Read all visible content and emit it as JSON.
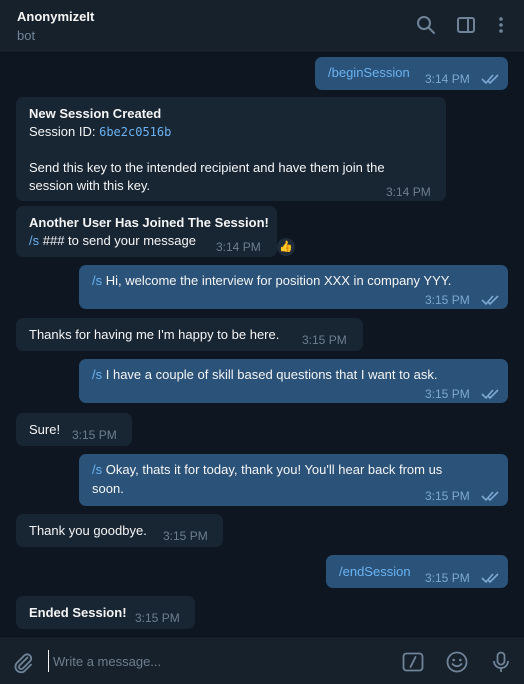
{
  "header": {
    "title": "AnonymizeIt",
    "subtitle": "bot",
    "icons": [
      "search-icon",
      "sidebar-toggle-icon",
      "more-vertical-icon"
    ]
  },
  "messages": [
    {
      "dir": "out",
      "cmd": "/beginSession",
      "time": "3:14 PM"
    },
    {
      "dir": "in",
      "title": "New Session Created",
      "id_label": "Session ID: ",
      "id_value": "6be2c0516b",
      "line1": "Send this key to the intended recipient and have them join the",
      "line2": "session with this key.",
      "time": "3:14 PM"
    },
    {
      "dir": "in",
      "title": "Another User Has Joined The Session!",
      "cmd": "/s",
      "text": " ### to send your message",
      "time": "3:14 PM",
      "reaction": "👍"
    },
    {
      "dir": "out",
      "cmd": "/s",
      "text": " Hi, welcome the interview for position XXX in company YYY.",
      "time": "3:15 PM"
    },
    {
      "dir": "in",
      "text": "Thanks for having me I'm happy to be here.",
      "time": "3:15 PM"
    },
    {
      "dir": "out",
      "cmd": "/s",
      "text": " I have a couple of skill based questions that I want to ask.",
      "time": "3:15 PM"
    },
    {
      "dir": "in",
      "text": "Sure!",
      "time": "3:15 PM"
    },
    {
      "dir": "out",
      "cmd": "/s",
      "line1": " Okay, thats it for today, thank you! You'll hear back from us",
      "line2": "soon.",
      "time": "3:15 PM"
    },
    {
      "dir": "in",
      "text": "Thank you goodbye.",
      "time": "3:15 PM"
    },
    {
      "dir": "out",
      "cmd": "/endSession",
      "time": "3:15 PM"
    },
    {
      "dir": "in",
      "title": "Ended Session!",
      "time": "3:15 PM"
    }
  ],
  "input": {
    "placeholder": "Write a message...",
    "icons": [
      "attach-icon",
      "commands-icon",
      "emoji-icon",
      "microphone-icon"
    ]
  },
  "colors": {
    "background": "#0e1621",
    "incoming": "#182533",
    "outgoing": "#2b5278",
    "link": "#6ab3f3"
  }
}
